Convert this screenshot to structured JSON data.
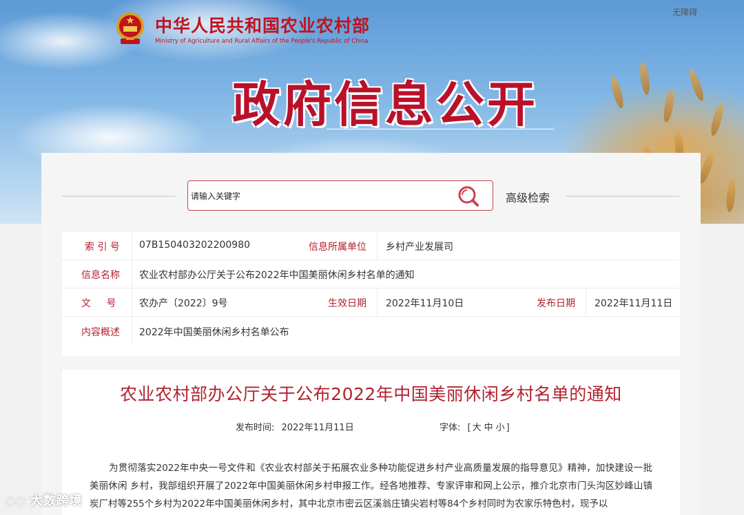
{
  "header": {
    "accessibility_label": "无障碍",
    "site_title_cn": "中华人民共和国农业农村部",
    "site_title_en": "Ministry of Agriculture and Rural Affairs of the People's Republic of China",
    "banner_title": "政府信息公开"
  },
  "search": {
    "placeholder": "请输入关键字",
    "advanced_label": "高级检索",
    "icon": "search-icon"
  },
  "metadata": {
    "index_label": "索 引 号",
    "index_value": "07B150403202200980",
    "unit_label": "信息所属单位",
    "unit_value": "乡村产业发展司",
    "name_label": "信息名称",
    "name_value": "农业农村部办公厅关于公布2022年中国美丽休闲乡村名单的通知",
    "doc_label": "文 号",
    "doc_value": "农办产〔2022〕9号",
    "effective_label": "生效日期",
    "effective_value": "2022年11月10日",
    "publish_label": "发布日期",
    "publish_value": "2022年11月11日",
    "summary_label": "内容概述",
    "summary_value": "2022年中国美丽休闲乡村名单公布"
  },
  "article": {
    "title": "农业农村部办公厅关于公布2022年中国美丽休闲乡村名单的通知",
    "publish_time_label": "发布时间:",
    "publish_time_value": "2022年11月11日",
    "font_label": "字体:",
    "font_open": "[",
    "font_large": "大",
    "font_medium": "中",
    "font_small": "小",
    "font_close": "]",
    "body": "为贯彻落实2022年中央一号文件和《农业农村部关于拓展农业多种功能促进乡村产业高质量发展的指导意见》精神，加快建设一批美丽休闲 乡村，我部组织开展了2022年中国美丽休闲乡村申报工作。经各地推荐、专家评审和网上公示，推介北京市门头沟区妙峰山镇炭厂村等255个乡村为2022年中国美丽休闲乡村，其中北京市密云区溪翁庄镇尖岩村等84个乡村同时为农家乐特色村，现予以"
  },
  "watermark": "大数跨境",
  "colors": {
    "brand_red": "#c1121f",
    "label_red": "#b0222f",
    "search_border": "#c9414e"
  }
}
